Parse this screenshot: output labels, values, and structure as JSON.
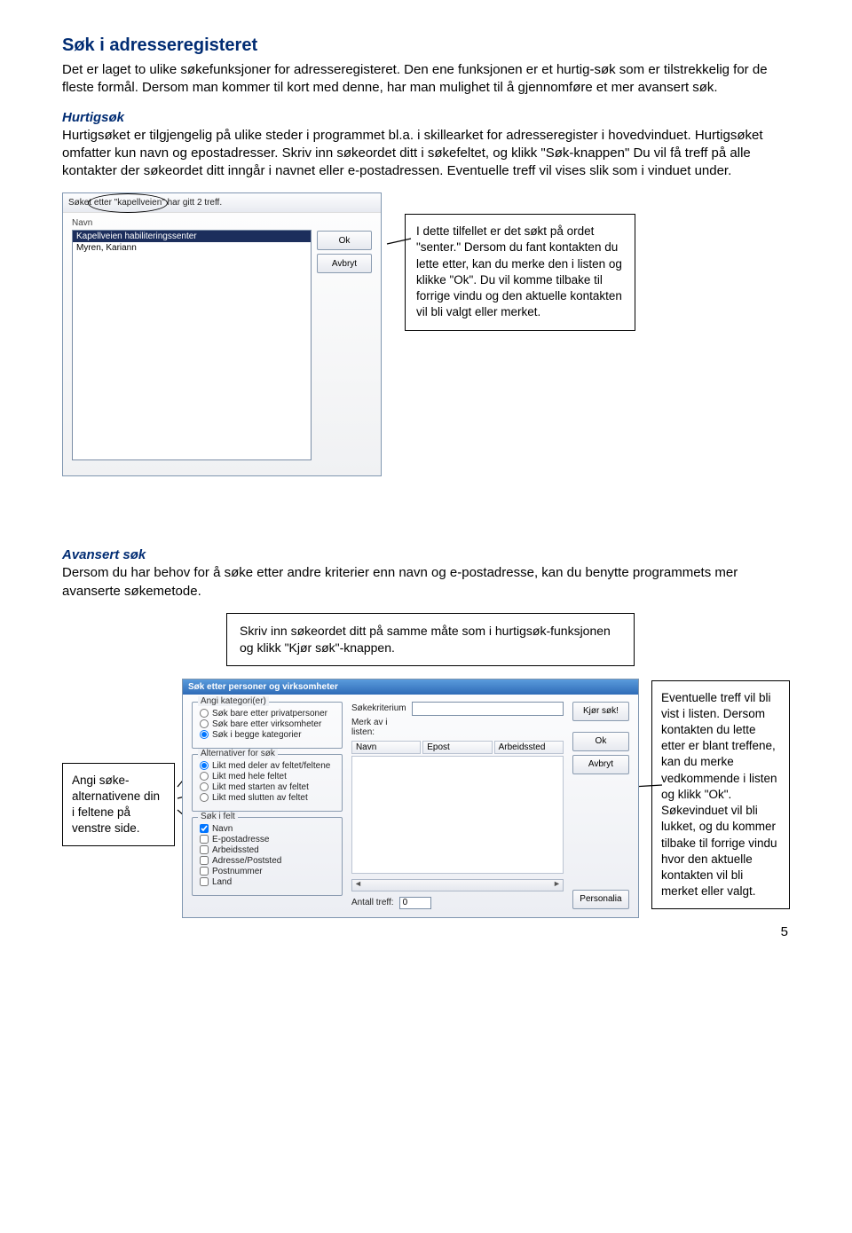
{
  "title": "Søk i adresseregisteret",
  "intro": "Det er laget to ulike søkefunksjoner for adresseregisteret. Den ene funksjonen er et hurtig-søk som er tilstrekkelig for de fleste formål. Dersom man kommer til kort med denne, har man mulighet til å gjennomføre et mer avansert søk.",
  "hurtig_head": "Hurtigsøk",
  "hurtig_body": "Hurtigsøket er tilgjengelig på ulike steder i programmet bl.a. i skillearket for adresseregister i hovedvinduet. Hurtigsøket omfatter kun navn og epostadresser. Skriv inn søkeordet ditt i søkefeltet, og klikk \"Søk-knappen\" Du vil få treff på alle kontakter der søkeordet ditt inngår i navnet eller e-postadressen. Eventuelle treff vil vises slik som i vinduet under.",
  "hurtig_panel": {
    "titlebar": "Søket etter \"kapellveien\" har gitt 2 treff.",
    "list_label": "Navn",
    "items": [
      "Kapellveien habiliteringssenter",
      "Myren, Kariann"
    ],
    "ok": "Ok",
    "avbryt": "Avbryt"
  },
  "hurtig_callout": "I dette tilfellet er det søkt på ordet \"senter.\" Dersom du fant kontakten du lette etter, kan du merke den i listen og klikke \"Ok\". Du vil komme tilbake til forrige vindu og den aktuelle kontakten vil bli valgt eller merket.",
  "avansert_head": "Avansert søk",
  "avansert_body": "Dersom du har behov for å søke etter andre kriterier enn navn og e-postadresse, kan du benytte programmets mer avanserte søkemetode.",
  "tip_box": "Skriv inn søkeordet ditt på samme måte som i hurtigsøk-funksjonen og klikk \"Kjør søk\"-knappen.",
  "left_callout": "Angi søke-alternativene din i feltene på venstre side.",
  "adv_panel": {
    "title": "Søk etter personer og virksomheter",
    "grp1_title": "Angi kategori(er)",
    "grp1_opts": [
      "Søk bare etter privatpersoner",
      "Søk bare etter virksomheter",
      "Søk i begge kategorier"
    ],
    "grp2_title": "Alternativer for søk",
    "grp2_opts": [
      "Likt med deler av feltet/feltene",
      "Likt med hele feltet",
      "Likt med starten av feltet",
      "Likt med slutten av feltet"
    ],
    "grp3_title": "Søk i felt",
    "grp3_opts": [
      "Navn",
      "E-postadresse",
      "Arbeidssted",
      "Adresse/Poststed",
      "Postnummer",
      "Land"
    ],
    "kriterium_label": "Søkekriterium",
    "merk_label": "Merk av i listen:",
    "cols": [
      "Navn",
      "Epost",
      "Arbeidssted"
    ],
    "kjor": "Kjør søk!",
    "ok": "Ok",
    "avbryt": "Avbryt",
    "personalia": "Personalia",
    "antall_label": "Antall treff:",
    "antall_value": "0"
  },
  "right_callout": "Eventuelle treff vil bli vist i listen. Dersom kontakten du lette etter er blant treffene, kan du merke vedkommende i listen og klikk \"Ok\". Søkevinduet vil bli lukket, og du kommer tilbake til forrige vindu hvor den aktuelle kontakten vil bli merket eller valgt.",
  "page_number": "5"
}
